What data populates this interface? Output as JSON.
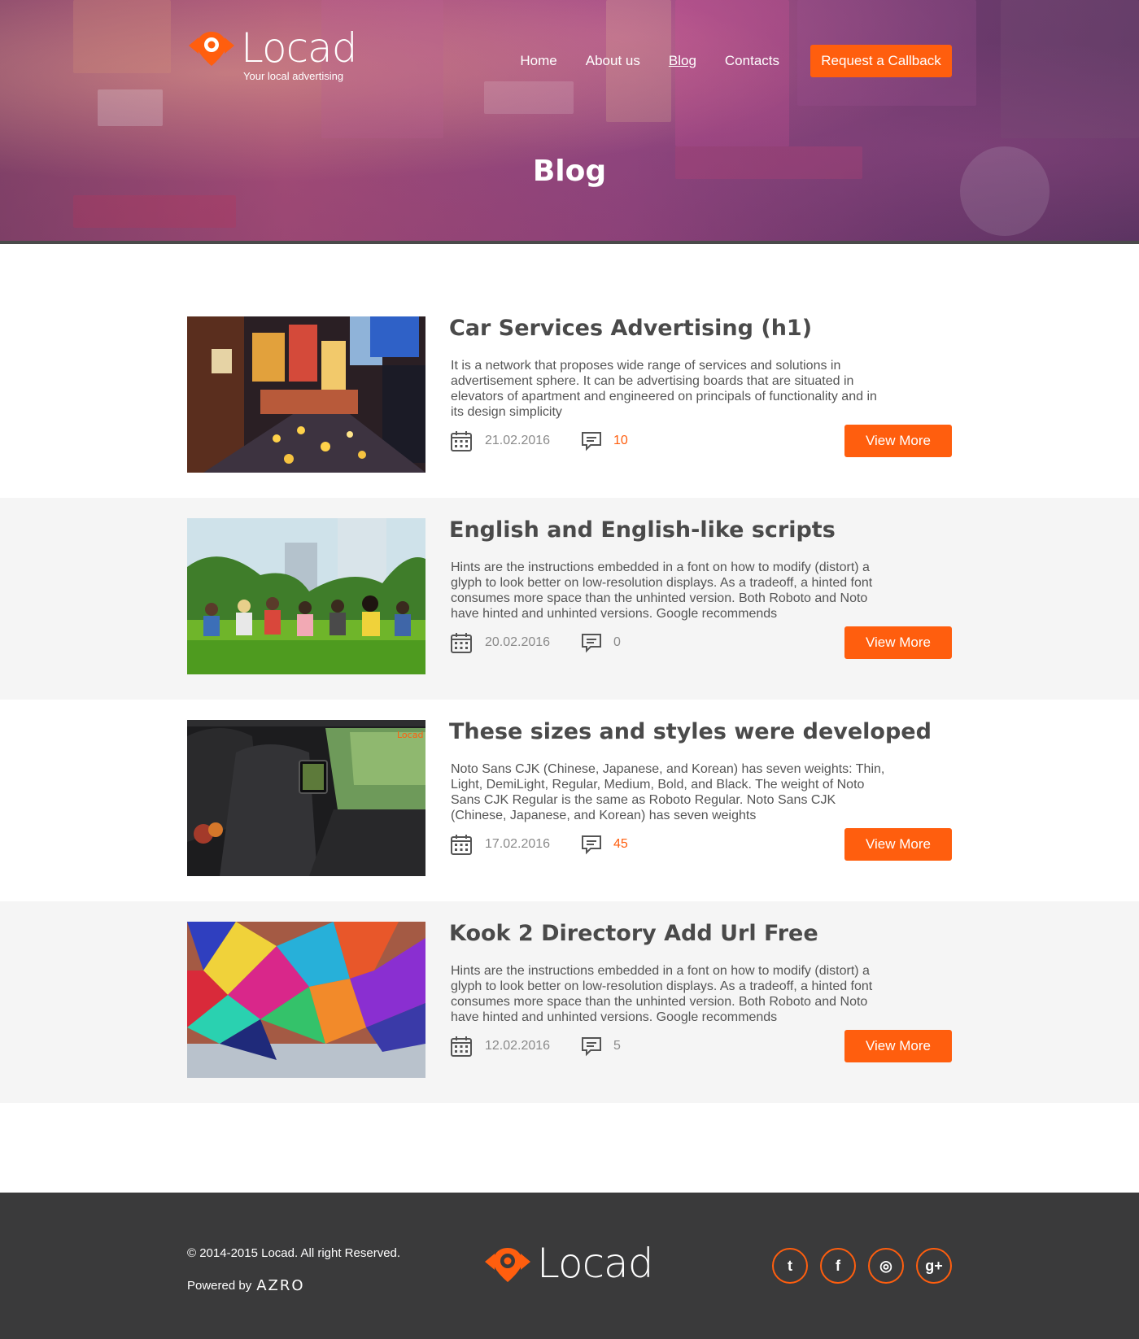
{
  "header": {
    "brand_name": "Locad",
    "brand_tagline": "Your local advertising",
    "nav": [
      {
        "label": "Home"
      },
      {
        "label": "About us"
      },
      {
        "label": "Blog",
        "active": true
      },
      {
        "label": "Contacts"
      }
    ],
    "callback_button": "Request a Callback",
    "page_title": "Blog"
  },
  "posts": [
    {
      "title": "Car Services Advertising (h1)",
      "text": "It is a network that proposes wide range of services and solutions in advertisement sphere.  It can be advertising boards that are situated in elevators of apartment and engineered on principals of functionality and in its design simplicity",
      "date": "21.02.2016",
      "comments": "10",
      "button": "View More",
      "image": "times-square-night-photo"
    },
    {
      "title": "English and English-like scripts",
      "text": "Hints are the instructions embedded in a font on how to modify (distort) a glyph to look better on low-resolution displays. As a tradeoff, a hinted font consumes more space than the unhinted version. Both Roboto and Noto have hinted and unhinted versions. Google recommends",
      "date": "20.02.2016",
      "comments": "0",
      "button": "View More",
      "image": "students-on-grass-photo"
    },
    {
      "title": "These sizes and styles were developed",
      "text": "Noto Sans CJK (Chinese, Japanese, and Korean) has seven weights: Thin, Light, DemiLight, Regular, Medium, Bold, and Black. The weight of Noto Sans CJK Regular is the same as Roboto Regular. Noto Sans CJK (Chinese, Japanese, and Korean) has seven weights",
      "date": "17.02.2016",
      "comments": "45",
      "button": "View More",
      "image": "car-interior-tablet-photo"
    },
    {
      "title": "Kook 2 Directory Add Url Free",
      "text": "Hints are the instructions embedded in a font on how to modify (distort) a glyph to look better on low-resolution displays. As a tradeoff, a hinted font consumes more space than the unhinted version. Both Roboto and Noto have hinted and unhinted versions. Google recommends",
      "date": "12.02.2016",
      "comments": "5",
      "button": "View More",
      "image": "graffiti-wall-photo"
    }
  ],
  "footer": {
    "copyright": "© 2014-2015 Locad. All right Reserved.",
    "powered_by": "Powered by",
    "powered_brand": "AZRO",
    "brand_name": "Locad",
    "socials": [
      {
        "icon": "twitter-icon",
        "glyph": "t"
      },
      {
        "icon": "facebook-icon",
        "glyph": "f"
      },
      {
        "icon": "instagram-icon",
        "glyph": "◎"
      },
      {
        "icon": "google-plus-icon",
        "glyph": "g+"
      }
    ]
  },
  "colors": {
    "accent": "#ff5e0e",
    "footer_bg": "#3a3a3b",
    "alt_row_bg": "#f5f5f5",
    "text": "#4a4a4a"
  }
}
